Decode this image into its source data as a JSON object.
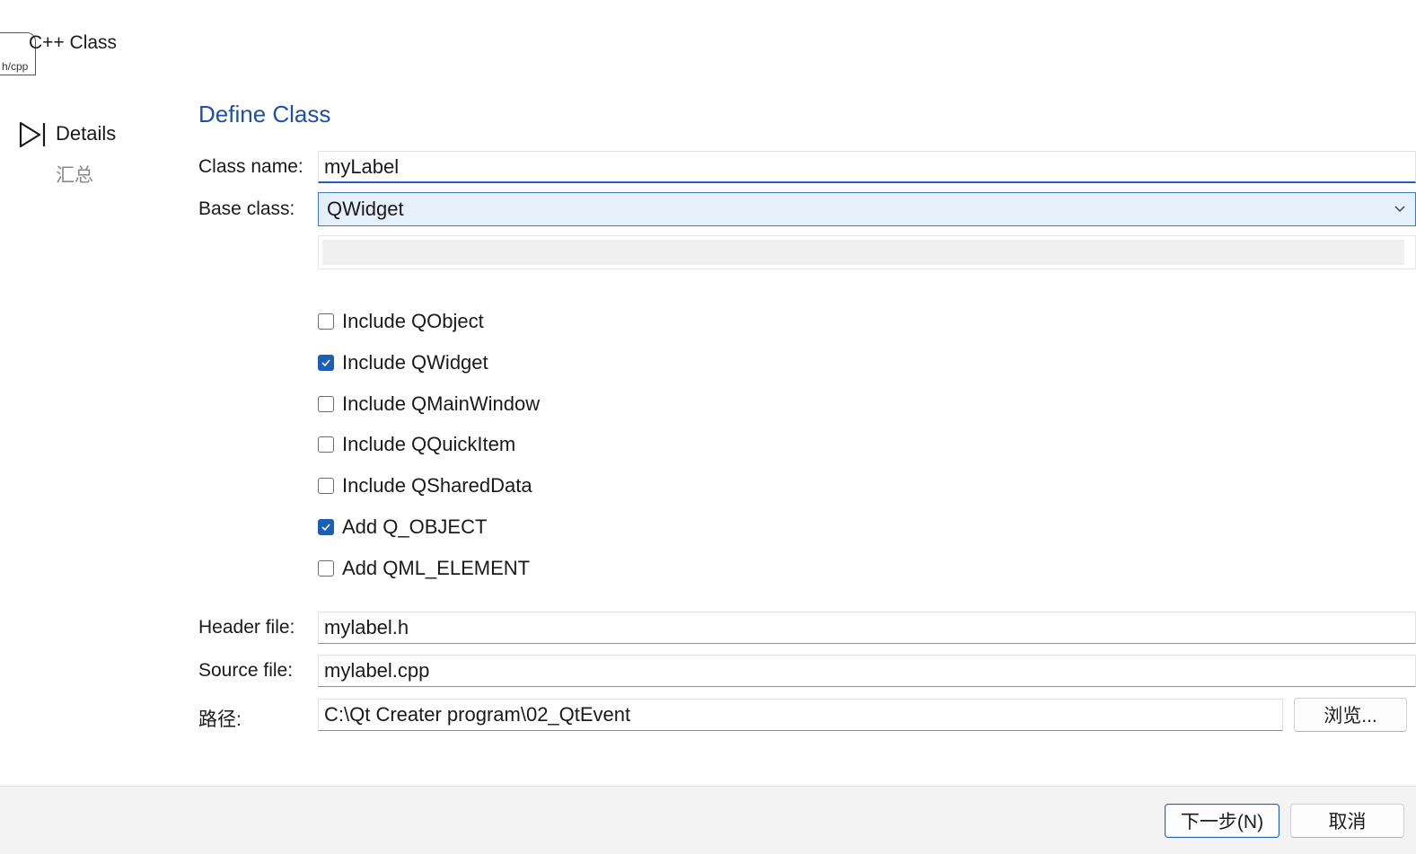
{
  "header": {
    "file_icon_ext": "h/cpp",
    "title": "C++ Class"
  },
  "steps": {
    "current": "Details",
    "next": "汇总"
  },
  "section": {
    "title": "Define Class"
  },
  "form": {
    "class_name_label": "Class name:",
    "class_name_value": "myLabel",
    "base_class_label": "Base class:",
    "base_class_value": "QWidget",
    "checkboxes": [
      {
        "label": "Include QObject",
        "checked": false
      },
      {
        "label": "Include QWidget",
        "checked": true
      },
      {
        "label": "Include QMainWindow",
        "checked": false
      },
      {
        "label": "Include QQuickItem",
        "checked": false
      },
      {
        "label": "Include QSharedData",
        "checked": false
      },
      {
        "label": "Add Q_OBJECT",
        "checked": true
      },
      {
        "label": "Add QML_ELEMENT",
        "checked": false
      }
    ],
    "header_file_label": "Header file:",
    "header_file_value": "mylabel.h",
    "source_file_label": "Source file:",
    "source_file_value": "mylabel.cpp",
    "path_label": "路径:",
    "path_value": "C:\\Qt Creater program\\02_QtEvent",
    "browse_label": "浏览..."
  },
  "footer": {
    "next_label": "下一步(N)",
    "cancel_label": "取消"
  },
  "colors": {
    "accent": "#1a5fb4",
    "title_blue": "#1f4fa8",
    "combo_bg": "#e6f0fa"
  }
}
